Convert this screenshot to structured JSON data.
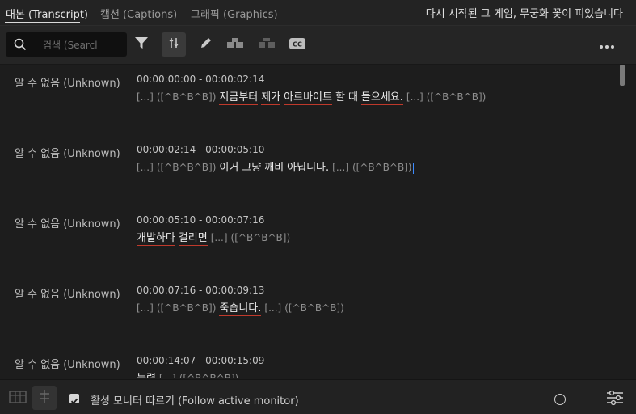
{
  "tabs": [
    {
      "label": "대본 (Transcript)",
      "active": true
    },
    {
      "label": "캡션 (Captions)",
      "active": false
    },
    {
      "label": "그래픽 (Graphics)",
      "active": false
    }
  ],
  "doc_title": "다시 시작된 그 게임, 무궁화 꽃이 피었습니다",
  "toolbar": {
    "search_placeholder": "검색 (Searcl",
    "icons": [
      "filter-icon",
      "split-segment-icon",
      "pencil-icon",
      "merge-icon",
      "split-icon",
      "cc-icon",
      "more-icon"
    ]
  },
  "entries": [
    {
      "speaker": "알 수 없음 (Unknown)",
      "timecode": "00:00:00:00 - 00:00:02:14",
      "tokens": [
        {
          "t": "[...]",
          "s": "dim"
        },
        {
          "t": "([^B^B^B])",
          "s": "dim"
        },
        {
          "t": "지금부터",
          "s": "word"
        },
        {
          "t": "제가",
          "s": "word"
        },
        {
          "t": "아르바이트",
          "s": "word"
        },
        {
          "t": "할",
          "s": "plain"
        },
        {
          "t": "때",
          "s": "plain"
        },
        {
          "t": "들으세요.",
          "s": "word"
        },
        {
          "t": "[...]",
          "s": "dim"
        },
        {
          "t": "([^B^B^B])",
          "s": "dim"
        }
      ]
    },
    {
      "speaker": "알 수 없음 (Unknown)",
      "timecode": "00:00:02:14 - 00:00:05:10",
      "tokens": [
        {
          "t": "[...]",
          "s": "dim"
        },
        {
          "t": "([^B^B^B])",
          "s": "dim"
        },
        {
          "t": "이거",
          "s": "word"
        },
        {
          "t": "그냥",
          "s": "word"
        },
        {
          "t": "깨비",
          "s": "word"
        },
        {
          "t": "아닙니다.",
          "s": "word"
        },
        {
          "t": "[...]",
          "s": "dim"
        },
        {
          "t": "([^B^B^B])",
          "s": "dim"
        }
      ]
    },
    {
      "speaker": "알 수 없음 (Unknown)",
      "timecode": "00:00:05:10 - 00:00:07:16",
      "tokens": [
        {
          "t": "개발하다",
          "s": "word"
        },
        {
          "t": "걸리면",
          "s": "word"
        },
        {
          "t": "[...]",
          "s": "dim"
        },
        {
          "t": "([^B^B^B])",
          "s": "dim"
        }
      ]
    },
    {
      "speaker": "알 수 없음 (Unknown)",
      "timecode": "00:00:07:16 - 00:00:09:13",
      "tokens": [
        {
          "t": "[...]",
          "s": "dim"
        },
        {
          "t": "([^B^B^B])",
          "s": "dim"
        },
        {
          "t": "죽습니다.",
          "s": "word"
        },
        {
          "t": "[...]",
          "s": "dim"
        },
        {
          "t": "([^B^B^B])",
          "s": "dim"
        }
      ]
    },
    {
      "speaker": "알 수 없음 (Unknown)",
      "timecode": "00:00:14:07 - 00:00:15:09",
      "tokens": [
        {
          "t": "능력",
          "s": "word"
        },
        {
          "t": "[...]",
          "s": "dim"
        },
        {
          "t": "([^B^B^B])",
          "s": "dim"
        }
      ]
    }
  ],
  "bottom": {
    "follow_label": "활성 모니터 따르기 (Follow active monitor)",
    "follow_checked": true,
    "zoom_level": 0.5
  }
}
